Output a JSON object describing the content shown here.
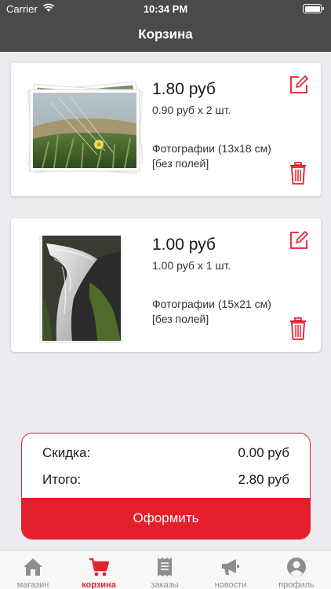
{
  "status": {
    "carrier": "Carrier",
    "time": "10:34 PM"
  },
  "header": {
    "title": "Корзина"
  },
  "cart": {
    "items": [
      {
        "price": "1.80 руб",
        "calc": "0.90 руб x 2 шт.",
        "desc_line1": "Фотографии (13x18 см)",
        "desc_line2": "[без полей]"
      },
      {
        "price": "1.00 руб",
        "calc": "1.00 руб x 1 шт.",
        "desc_line1": "Фотографии (15x21 см)",
        "desc_line2": "[без полей]"
      }
    ]
  },
  "summary": {
    "discount_label": "Скидка:",
    "discount_value": "0.00 руб",
    "total_label": "Итого:",
    "total_value": "2.80 руб",
    "checkout_label": "Оформить"
  },
  "tabs": [
    {
      "label": "магазин",
      "icon": "home-icon"
    },
    {
      "label": "корзина",
      "icon": "cart-icon",
      "active": true
    },
    {
      "label": "заказы",
      "icon": "receipt-icon"
    },
    {
      "label": "новости",
      "icon": "megaphone-icon"
    },
    {
      "label": "профиль",
      "icon": "user-icon"
    }
  ],
  "colors": {
    "accent": "#e41f2d",
    "header_bg": "#4a4a4a",
    "page_bg": "#ecebf0"
  }
}
